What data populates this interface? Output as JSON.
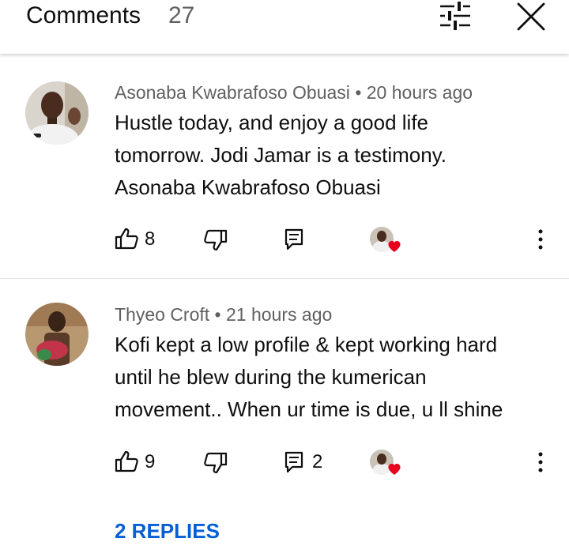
{
  "header": {
    "title": "Comments",
    "count": "27"
  },
  "comments": [
    {
      "author": "Asonaba Kwabrafoso Obuasi",
      "time": "20 hours ago",
      "text_lines": [
        "Hustle today, and enjoy a good life",
        "tomorrow. Jodi Jamar is a testimony.",
        "Asonaba Kwabrafoso Obuasi"
      ],
      "likes": "8",
      "reply_count": ""
    },
    {
      "author": "Thyeo Croft",
      "time": "21 hours ago",
      "text_lines": [
        "Kofi kept a low profile & kept working hard",
        "until he blew during the kumerican",
        "movement.. When ur time is due, u ll shine"
      ],
      "likes": "9",
      "reply_count": "2"
    }
  ],
  "separator": "•",
  "replies_link": "2 REPLIES",
  "colors": {
    "link": "#065fd4",
    "heart": "#e8001c",
    "meta": "#606060"
  }
}
